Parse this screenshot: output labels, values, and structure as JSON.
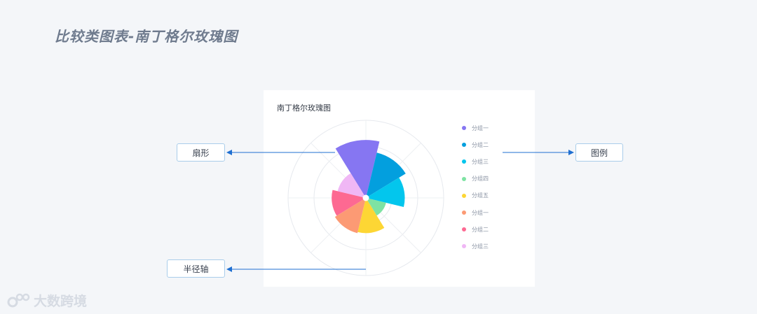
{
  "page": {
    "title": "比较类图表-南丁格尔玫瑰图"
  },
  "chart_data": {
    "type": "nightingale-rose",
    "title": "南丁格尔玫瑰图",
    "legend_position": "right",
    "categories": [
      "分组一",
      "分组二",
      "分组三",
      "分组四",
      "分组五",
      "分组一",
      "分组二",
      "分组三"
    ],
    "values": [
      112,
      90,
      75,
      40,
      68,
      70,
      66,
      56
    ],
    "colors": [
      "#8676f2",
      "#039fde",
      "#03c6ed",
      "#7ee3a3",
      "#fdd634",
      "#fc9a74",
      "#fd6992",
      "#f0b7f5"
    ],
    "radial_max": 150,
    "grid_rings": [
      1,
      2,
      3
    ]
  },
  "annotations": {
    "sector": "扇形",
    "legend": "图例",
    "radial_axis": "半径轴"
  },
  "colors": {
    "arrow": "#1f6fd1",
    "callout_border": "#a9cdea"
  },
  "brand": {
    "icon": "brand-logo-icon",
    "text": "大数跨境"
  }
}
